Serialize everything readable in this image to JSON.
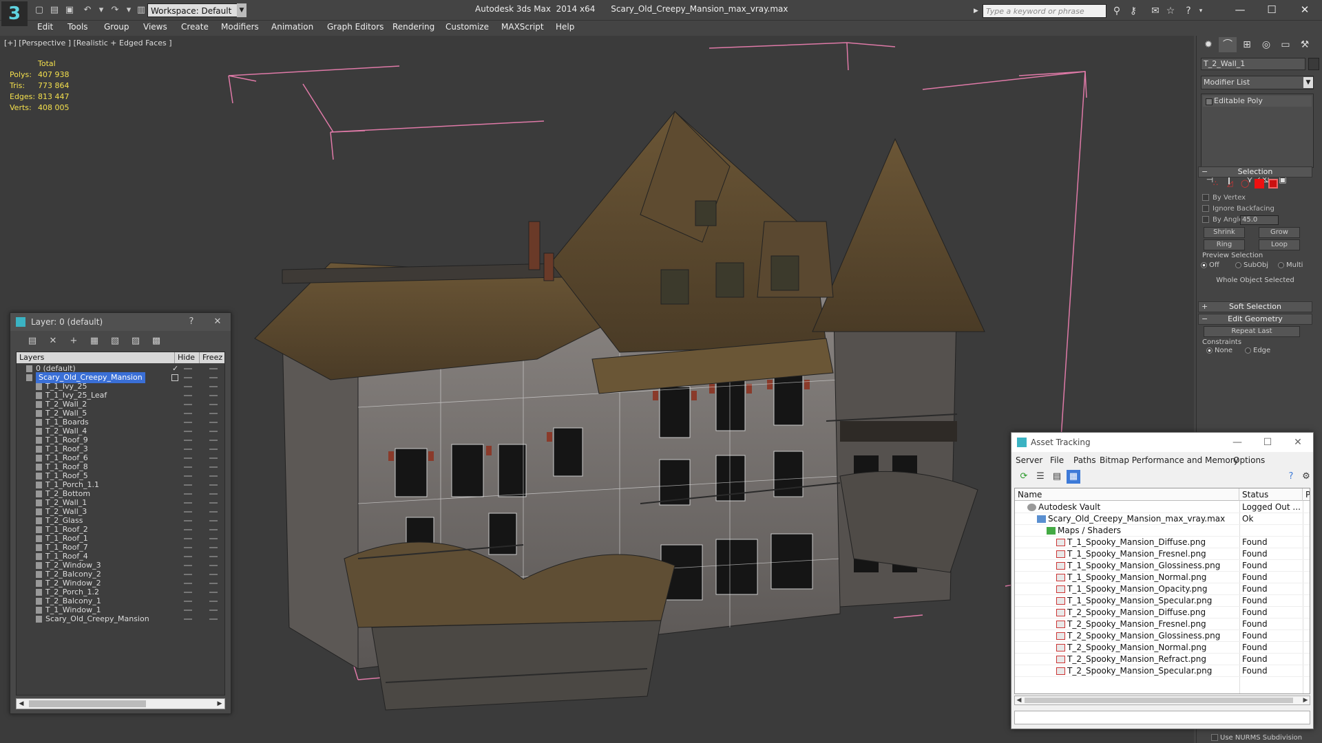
{
  "titlebar": {
    "app_title": "Autodesk 3ds Max  2014 x64",
    "file_title": "Scary_Old_Creepy_Mansion_max_vray.max",
    "workspace": "Workspace: Default",
    "search_placeholder": "Type a keyword or phrase"
  },
  "menu": [
    "Edit",
    "Tools",
    "Group",
    "Views",
    "Create",
    "Modifiers",
    "Animation",
    "Graph Editors",
    "Rendering",
    "Customize",
    "MAXScript",
    "Help"
  ],
  "viewport": {
    "label": "[+] [Perspective ] [Realistic + Edged Faces ]",
    "stats": {
      "header": "Total",
      "rows": [
        {
          "k": "Polys:",
          "v": "407 938"
        },
        {
          "k": "Tris:",
          "v": "773 864"
        },
        {
          "k": "Edges:",
          "v": "813 447"
        },
        {
          "k": "Verts:",
          "v": "408 005"
        }
      ]
    }
  },
  "command_panel": {
    "object_name": "T_2_Wall_1",
    "modifier_list": "Modifier List",
    "stack_item": "Editable Poly",
    "selection_header": "Selection",
    "by_vertex": "By Vertex",
    "ignore_backfacing": "Ignore Backfacing",
    "by_angle": "By Angle:",
    "angle_value": "45.0",
    "shrink": "Shrink",
    "grow": "Grow",
    "ring": "Ring",
    "loop": "Loop",
    "preview_selection": "Preview Selection",
    "preview_off": "Off",
    "preview_subobj": "SubObj",
    "preview_multi": "Multi",
    "whole_object": "Whole Object Selected",
    "soft_selection": "Soft Selection",
    "edit_geometry": "Edit Geometry",
    "repeat_last": "Repeat Last",
    "constraints": "Constraints",
    "c_none": "None",
    "c_edge": "Edge",
    "use_nurms": "Use NURMS Subdivision"
  },
  "layer_dialog": {
    "title": "Layer: 0 (default)",
    "help": "?",
    "col_layers": "Layers",
    "col_hide": "Hide",
    "col_freeze": "Freez",
    "rows": [
      {
        "name": "0 (default)",
        "level": 0,
        "checked": true
      },
      {
        "name": "Scary_Old_Creepy_Mansion",
        "level": 0,
        "selected": true
      },
      {
        "name": "T_1_Ivy_25",
        "level": 1
      },
      {
        "name": "T_1_Ivy_25_Leaf",
        "level": 1
      },
      {
        "name": "T_2_Wall_2",
        "level": 1
      },
      {
        "name": "T_2_Wall_5",
        "level": 1
      },
      {
        "name": "T_1_Boards",
        "level": 1
      },
      {
        "name": "T_2_Wall_4",
        "level": 1
      },
      {
        "name": "T_1_Roof_9",
        "level": 1
      },
      {
        "name": "T_1_Roof_3",
        "level": 1
      },
      {
        "name": "T_1_Roof_6",
        "level": 1
      },
      {
        "name": "T_1_Roof_8",
        "level": 1
      },
      {
        "name": "T_1_Roof_5",
        "level": 1
      },
      {
        "name": "T_1_Porch_1.1",
        "level": 1
      },
      {
        "name": "T_2_Bottom",
        "level": 1
      },
      {
        "name": "T_2_Wall_1",
        "level": 1
      },
      {
        "name": "T_2_Wall_3",
        "level": 1
      },
      {
        "name": "T_2_Glass",
        "level": 1
      },
      {
        "name": "T_1_Roof_2",
        "level": 1
      },
      {
        "name": "T_1_Roof_1",
        "level": 1
      },
      {
        "name": "T_1_Roof_7",
        "level": 1
      },
      {
        "name": "T_1_Roof_4",
        "level": 1
      },
      {
        "name": "T_2_Window_3",
        "level": 1
      },
      {
        "name": "T_2_Balcony_2",
        "level": 1
      },
      {
        "name": "T_2_Window_2",
        "level": 1
      },
      {
        "name": "T_2_Porch_1.2",
        "level": 1
      },
      {
        "name": "T_2_Balcony_1",
        "level": 1
      },
      {
        "name": "T_1_Window_1",
        "level": 1
      },
      {
        "name": "Scary_Old_Creepy_Mansion",
        "level": 1
      }
    ]
  },
  "asset_tracking": {
    "title": "Asset Tracking",
    "menu": [
      "Server",
      "File",
      "Paths",
      "Bitmap Performance and Memory",
      "Options"
    ],
    "col_name": "Name",
    "col_status": "Status",
    "col_extra": "Pr",
    "rows": [
      {
        "name": "Autodesk Vault",
        "status": "Logged Out ...",
        "level": 0,
        "icon": "vault"
      },
      {
        "name": "Scary_Old_Creepy_Mansion_max_vray.max",
        "status": "Ok",
        "level": 1,
        "icon": "file"
      },
      {
        "name": "Maps / Shaders",
        "status": "",
        "level": 2,
        "icon": "maps"
      },
      {
        "name": "T_1_Spooky_Mansion_Diffuse.png",
        "status": "Found",
        "level": 3,
        "icon": "png"
      },
      {
        "name": "T_1_Spooky_Mansion_Fresnel.png",
        "status": "Found",
        "level": 3,
        "icon": "png"
      },
      {
        "name": "T_1_Spooky_Mansion_Glossiness.png",
        "status": "Found",
        "level": 3,
        "icon": "png"
      },
      {
        "name": "T_1_Spooky_Mansion_Normal.png",
        "status": "Found",
        "level": 3,
        "icon": "png"
      },
      {
        "name": "T_1_Spooky_Mansion_Opacity.png",
        "status": "Found",
        "level": 3,
        "icon": "png"
      },
      {
        "name": "T_1_Spooky_Mansion_Specular.png",
        "status": "Found",
        "level": 3,
        "icon": "png"
      },
      {
        "name": "T_2_Spooky_Mansion_Diffuse.png",
        "status": "Found",
        "level": 3,
        "icon": "png"
      },
      {
        "name": "T_2_Spooky_Mansion_Fresnel.png",
        "status": "Found",
        "level": 3,
        "icon": "png"
      },
      {
        "name": "T_2_Spooky_Mansion_Glossiness.png",
        "status": "Found",
        "level": 3,
        "icon": "png"
      },
      {
        "name": "T_2_Spooky_Mansion_Normal.png",
        "status": "Found",
        "level": 3,
        "icon": "png"
      },
      {
        "name": "T_2_Spooky_Mansion_Refract.png",
        "status": "Found",
        "level": 3,
        "icon": "png"
      },
      {
        "name": "T_2_Spooky_Mansion_Specular.png",
        "status": "Found",
        "level": 3,
        "icon": "png"
      }
    ]
  },
  "colors": {
    "stats_text": "#f4e04d",
    "selection_blue": "#3a6fd6",
    "bbox_pink": "#e07aa8"
  }
}
